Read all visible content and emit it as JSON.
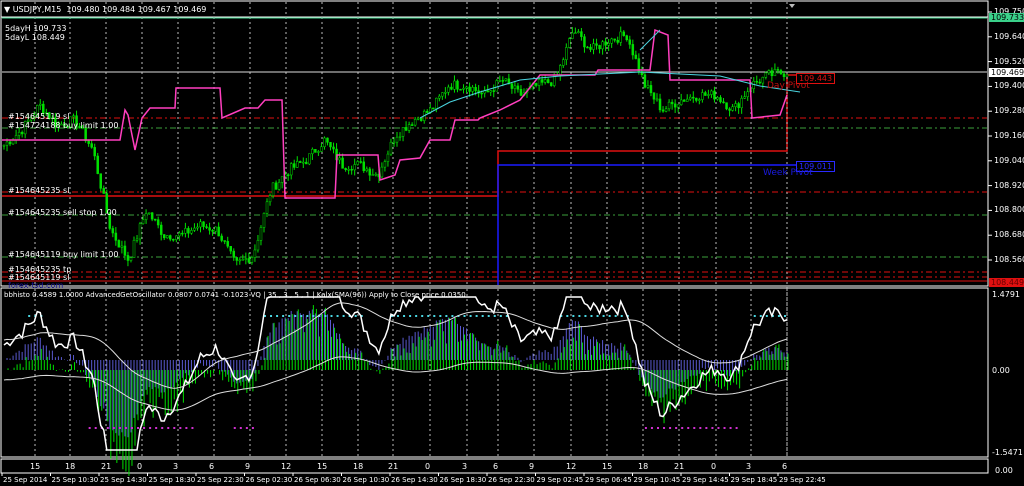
{
  "header": {
    "symbol": "USDJPY,M15",
    "ohlc": "109.480 109.484 109.467 109.469",
    "five_day_high": "5dayH 109.733",
    "five_day_low": "5dayL 108.449"
  },
  "orders": [
    "#154645119 sl",
    "#154724188 buy limit 1.00",
    "#154645235 sl",
    "#154645235 sell stop 1.00",
    "#154645119 buy limit 1.00",
    "#154645235 tp",
    "#154645119 sl"
  ],
  "watermark": "forex-tsd.com",
  "pivots": {
    "day_label": "Day Pivot",
    "day_value": "109.443",
    "week_label": "Week Pivot",
    "week_value": "109.011"
  },
  "price_axis": {
    "ticks": [
      "109.750",
      "109.640",
      "109.520",
      "109.400",
      "109.280",
      "109.160",
      "109.040",
      "108.920",
      "108.800",
      "108.680",
      "108.560"
    ],
    "high_tag": "109.733",
    "bid_tag": "109.469",
    "low_tag": "108.449"
  },
  "indicator": {
    "legend": "bbhisto 0.4589 1.0000  AdvancedGetOscillator 0.0807 0.0741 -0.1023  VQ | 35 , 3 , 5 , 1 |  Kalx(SMA(96)) Apply to Close price 0.0350",
    "ticks": [
      "1.4791",
      "0.00",
      "-1.5471"
    ]
  },
  "time_axis": {
    "hours": [
      "15",
      "18",
      "21",
      "0",
      "3",
      "6",
      "9",
      "12",
      "15",
      "18",
      "21",
      "0",
      "3",
      "6",
      "9",
      "12",
      "15",
      "18",
      "21",
      "0",
      "3",
      "6"
    ],
    "dates": [
      "25 Sep 2014",
      "25 Sep 10:30",
      "25 Sep 14:30",
      "25 Sep 18:30",
      "25 Sep 22:30",
      "26 Sep 02:30",
      "26 Sep 06:30",
      "26 Sep 10:30",
      "26 Sep 14:30",
      "26 Sep 18:30",
      "26 Sep 22:30",
      "29 Sep 02:45",
      "29 Sep 06:45",
      "29 Sep 10:45",
      "29 Sep 14:45",
      "29 Sep 18:45",
      "29 Sep 22:45"
    ],
    "corner": "0.00"
  },
  "colors": {
    "candle": "#00e000",
    "pink": "#ff3fbf",
    "red": "#e01010",
    "green_level": "#3da03d",
    "blue": "#1a1aff",
    "cyan": "#4ad5e0",
    "magenta": "#d030d0",
    "hist_blue": "#5a5ad0"
  },
  "chart_data": {
    "type": "line",
    "title": "USDJPY,M15",
    "ylim": [
      108.449,
      109.75
    ],
    "close_keypoints": [
      109.106,
      109.179,
      109.3,
      109.203,
      109.227,
      109.082,
      108.695,
      108.55,
      108.792,
      108.671,
      108.671,
      108.719,
      108.695,
      108.526,
      108.574,
      108.889,
      108.985,
      109.034,
      109.131,
      109.01,
      109.01,
      108.961,
      109.155,
      109.227,
      109.276,
      109.397,
      109.397,
      109.348,
      109.421,
      109.348,
      109.397,
      109.421,
      109.663,
      109.566,
      109.615,
      109.639,
      109.397,
      109.276,
      109.324,
      109.348,
      109.348,
      109.276,
      109.397,
      109.445,
      109.46
    ]
  }
}
